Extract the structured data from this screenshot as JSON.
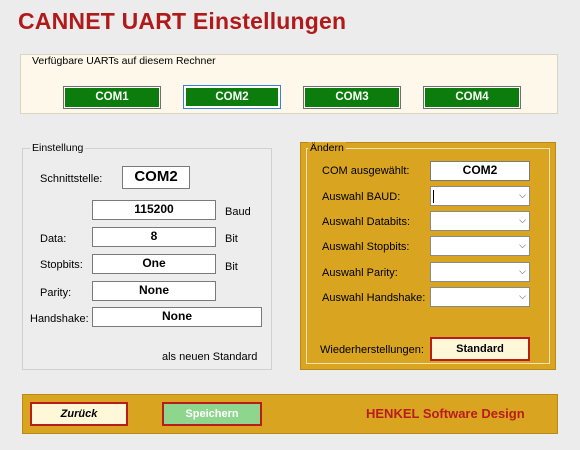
{
  "window": {
    "title": "CANNET UART Einstellungen"
  },
  "uarts": {
    "legend": "Verfügbare UARTs auf diesem Rechner",
    "ports": [
      "COM1",
      "COM2",
      "COM3",
      "COM4"
    ],
    "selected_index": 1
  },
  "einstellung": {
    "legend": "Einstellung",
    "schnittstelle_label": "Schnittstelle:",
    "schnittstelle_value": "COM2",
    "baud_value": "115200",
    "baud_unit": "Baud",
    "data_label": "Data:",
    "data_value": "8",
    "data_unit": "Bit",
    "stopbits_label": "Stopbits:",
    "stopbits_value": "One",
    "stopbits_unit": "Bit",
    "parity_label": "Parity:",
    "parity_value": "None",
    "handshake_label": "Handshake:",
    "handshake_value": "None",
    "standard_note": "als neuen Standard"
  },
  "aendern": {
    "legend": "Ändern",
    "com_label": "COM ausgewählt:",
    "com_value": "COM2",
    "baud_label": "Auswahl BAUD:",
    "databits_label": "Auswahl Databits:",
    "stopbits_label": "Auswahl Stopbits:",
    "parity_label": "Auswahl Parity:",
    "handshake_label": "Auswahl Handshake:",
    "restore_label": "Wiederherstellungen:",
    "standard_button": "Standard",
    "dropdown_icon": "chevron-down-icon"
  },
  "footer": {
    "back_button": "Zurück",
    "save_button": "Speichern",
    "brand": "HENKEL Software Design"
  },
  "colors": {
    "title_red": "#b11a1a",
    "com_green": "#0c7d0c",
    "panel_gold": "#d9a520",
    "save_green": "#8ed68e",
    "brand_red": "#b91c1c"
  }
}
